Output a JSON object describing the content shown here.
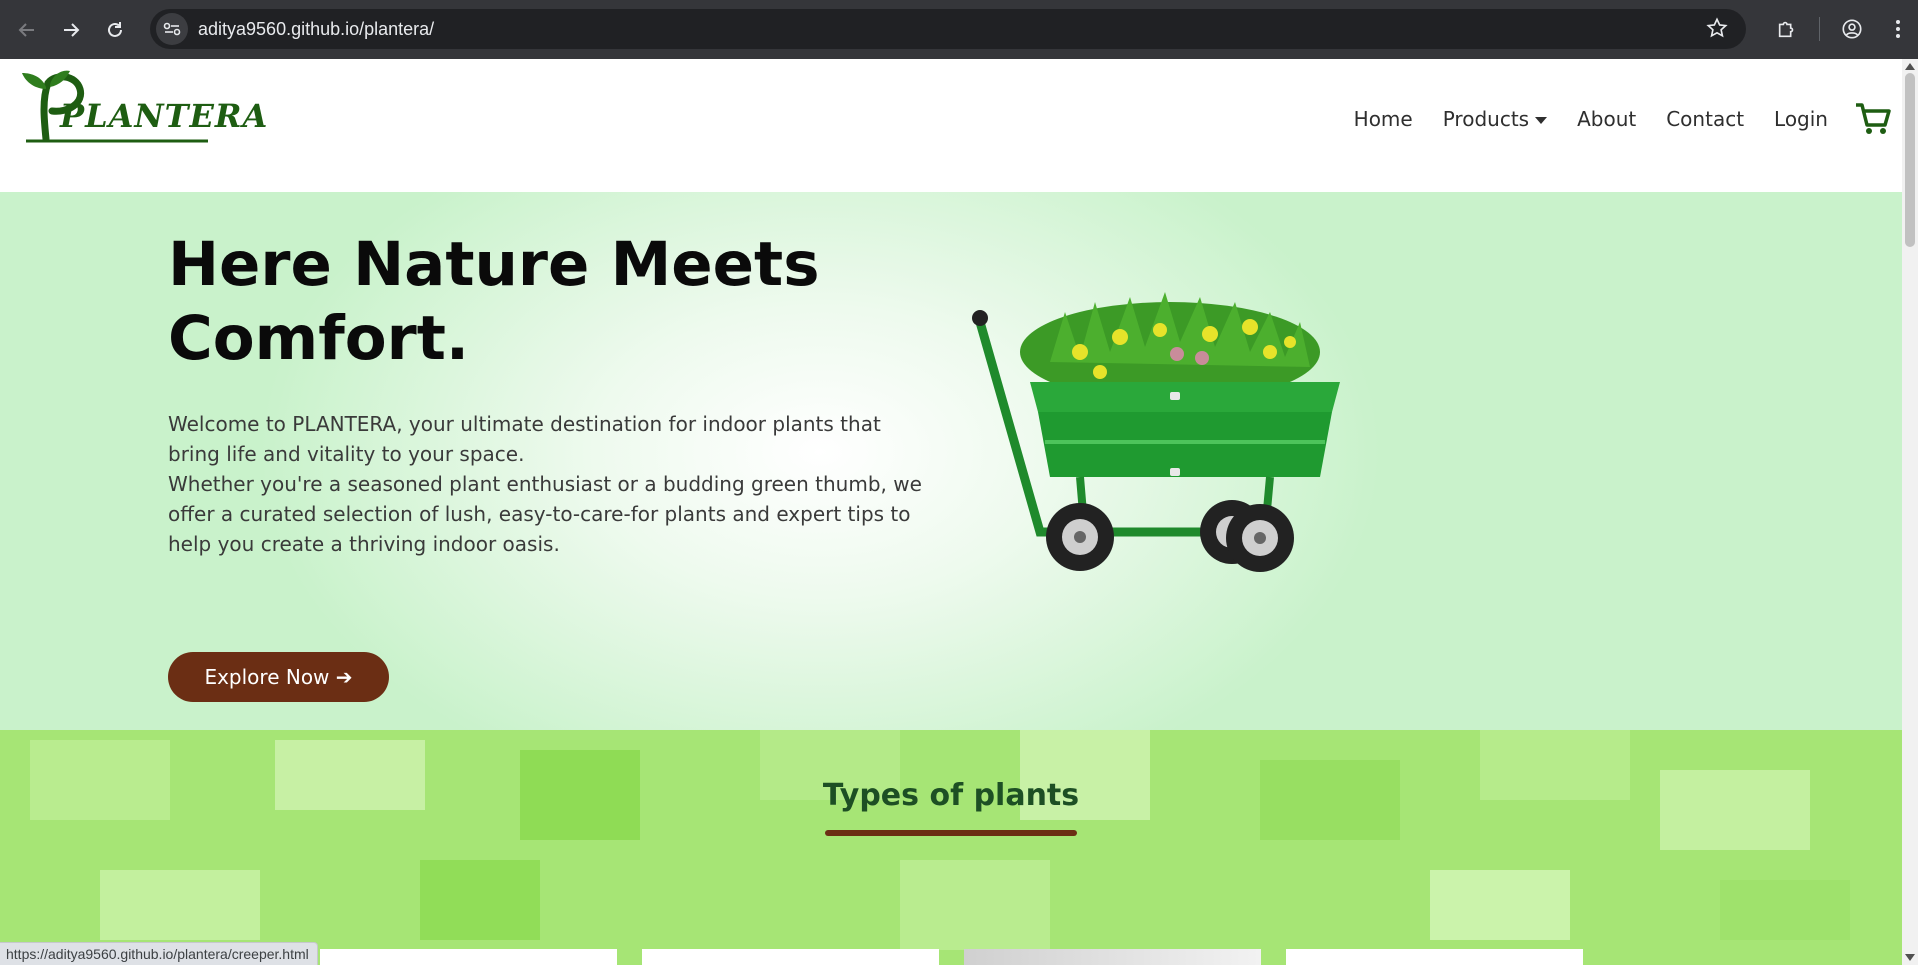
{
  "browser": {
    "url": "aditya9560.github.io/plantera/",
    "status_url": "https://aditya9560.github.io/plantera/creeper.html"
  },
  "site": {
    "logo_text": "PLANTERA",
    "nav": {
      "home": "Home",
      "products": "Products",
      "about": "About",
      "contact": "Contact",
      "login": "Login"
    },
    "hero": {
      "title": "Here Nature Meets Comfort.",
      "paragraph_1": "Welcome to PLANTERA, your ultimate destination for indoor plants that bring life and vitality to your space.",
      "paragraph_2": "Whether you're a seasoned plant enthusiast or a budding green thumb, we offer a curated selection of lush, easy-to-care-for plants and expert tips to help you create a thriving indoor oasis.",
      "button": "Explore Now ➔"
    },
    "types": {
      "title": "Types of plants"
    }
  },
  "colors": {
    "accent_brown": "#6b2e14",
    "brand_green": "#1e5d12",
    "hero_bg": "#c9f2cb",
    "types_bg": "#a6e575"
  }
}
